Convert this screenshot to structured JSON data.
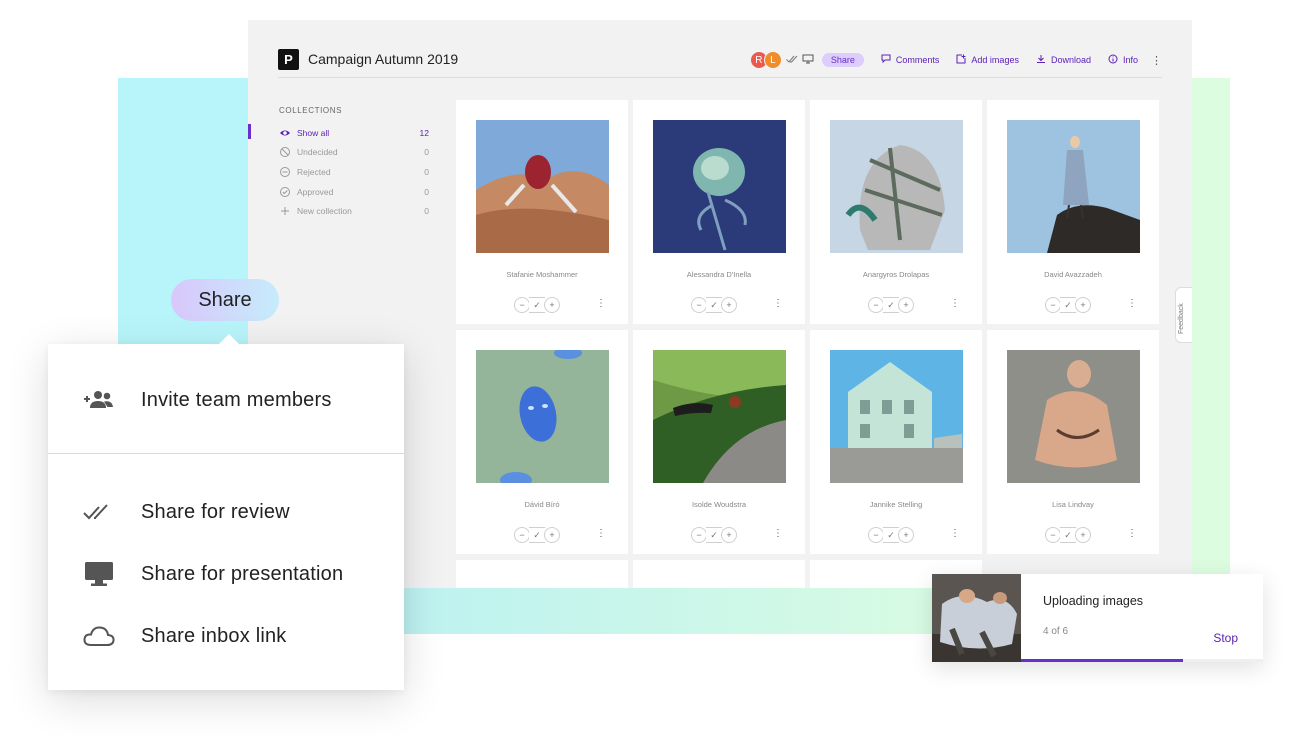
{
  "app": {
    "logo_letter": "P",
    "title": "Campaign Autumn 2019",
    "toolbar": {
      "avatars": [
        "R",
        "L"
      ],
      "share_label": "Share",
      "comments_label": "Comments",
      "add_images_label": "Add images",
      "download_label": "Download",
      "info_label": "Info"
    }
  },
  "sidebar": {
    "heading": "COLLECTIONS",
    "items": [
      {
        "icon": "eye-icon",
        "label": "Show all",
        "count": "12",
        "active": true
      },
      {
        "icon": "undecided-icon",
        "label": "Undecided",
        "count": "0"
      },
      {
        "icon": "rejected-icon",
        "label": "Rejected",
        "count": "0"
      },
      {
        "icon": "approved-icon",
        "label": "Approved",
        "count": "0"
      },
      {
        "icon": "plus-icon",
        "label": "New collection",
        "count": "0"
      }
    ]
  },
  "grid": {
    "cards": [
      {
        "name": "Stafanie Moshammer"
      },
      {
        "name": "Alessandra D'Inella"
      },
      {
        "name": "Anargyros Drolapas"
      },
      {
        "name": "David Avazzadeh"
      },
      {
        "name": "Dávid Bíró"
      },
      {
        "name": "Isolde Woudstra"
      },
      {
        "name": "Jannike Stelling"
      },
      {
        "name": "Lisa Lindvay"
      }
    ],
    "action_labels": {
      "reject": "−",
      "approve": "✓",
      "add": "+"
    }
  },
  "feedback_label": "Feedback",
  "share_bubble": {
    "label": "Share"
  },
  "share_menu": {
    "items": [
      {
        "icon": "invite-team-icon",
        "label": "Invite team members"
      },
      {
        "icon": "double-check-icon",
        "label": "Share for review"
      },
      {
        "icon": "monitor-icon",
        "label": "Share for presentation"
      },
      {
        "icon": "cloud-icon",
        "label": "Share inbox link"
      }
    ]
  },
  "upload": {
    "title": "Uploading images",
    "count": "4 of 6",
    "stop_label": "Stop",
    "progress": 0.67
  },
  "colors": {
    "accent": "#6a2fc9",
    "share_pill_bg": "#dccdfc",
    "bg_cyan": "#b8f5fa",
    "bg_green": "#dcfde0"
  }
}
